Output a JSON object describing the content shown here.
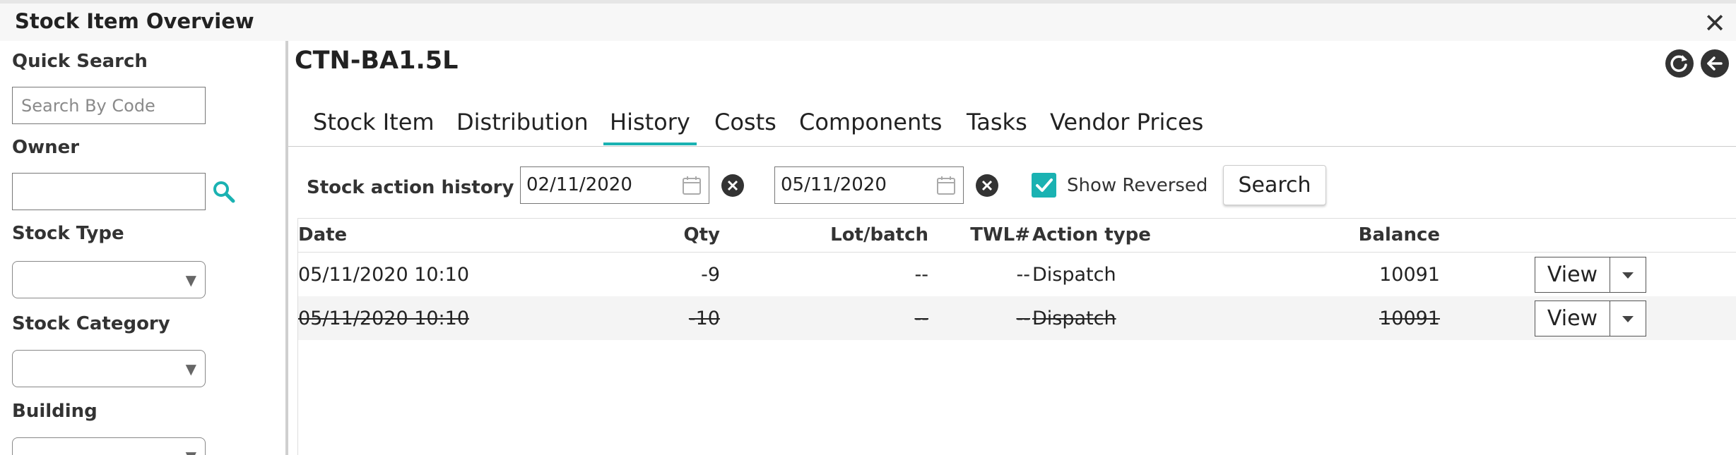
{
  "window": {
    "title": "Stock Item Overview"
  },
  "sidebar": {
    "quick_search_label": "Quick Search",
    "quick_search_placeholder": "Search By Code",
    "owner_label": "Owner",
    "owner_value": "",
    "stock_type_label": "Stock Type",
    "stock_category_label": "Stock Category",
    "building_label": "Building"
  },
  "item": {
    "code": "CTN-BA1.5L"
  },
  "tabs": [
    {
      "label": "Stock Item",
      "active": false
    },
    {
      "label": "Distribution",
      "active": false
    },
    {
      "label": "History",
      "active": true
    },
    {
      "label": "Costs",
      "active": false
    },
    {
      "label": "Components",
      "active": false
    },
    {
      "label": "Tasks",
      "active": false
    },
    {
      "label": "Vendor Prices",
      "active": false
    }
  ],
  "filters": {
    "label": "Stock action history",
    "date_from": "02/11/2020",
    "date_to": "05/11/2020",
    "show_reversed_label": "Show Reversed",
    "show_reversed_checked": true,
    "search_label": "Search"
  },
  "table": {
    "columns": {
      "date": "Date",
      "qty": "Qty",
      "lot": "Lot/batch",
      "twl": "TWL#",
      "action": "Action type",
      "balance": "Balance"
    },
    "rows": [
      {
        "date": "05/11/2020 10:10",
        "qty": "-9",
        "lot": "--",
        "twl": "--",
        "action": "Dispatch",
        "balance": "10091",
        "reversed": false,
        "view_label": "View"
      },
      {
        "date": "05/11/2020 10:10",
        "qty": "-10",
        "lot": "--",
        "twl": "--",
        "action": "Dispatch",
        "balance": "10091",
        "reversed": true,
        "view_label": "View"
      }
    ]
  },
  "colors": {
    "accent": "#1ab2b2",
    "icon_dark": "#333333"
  }
}
